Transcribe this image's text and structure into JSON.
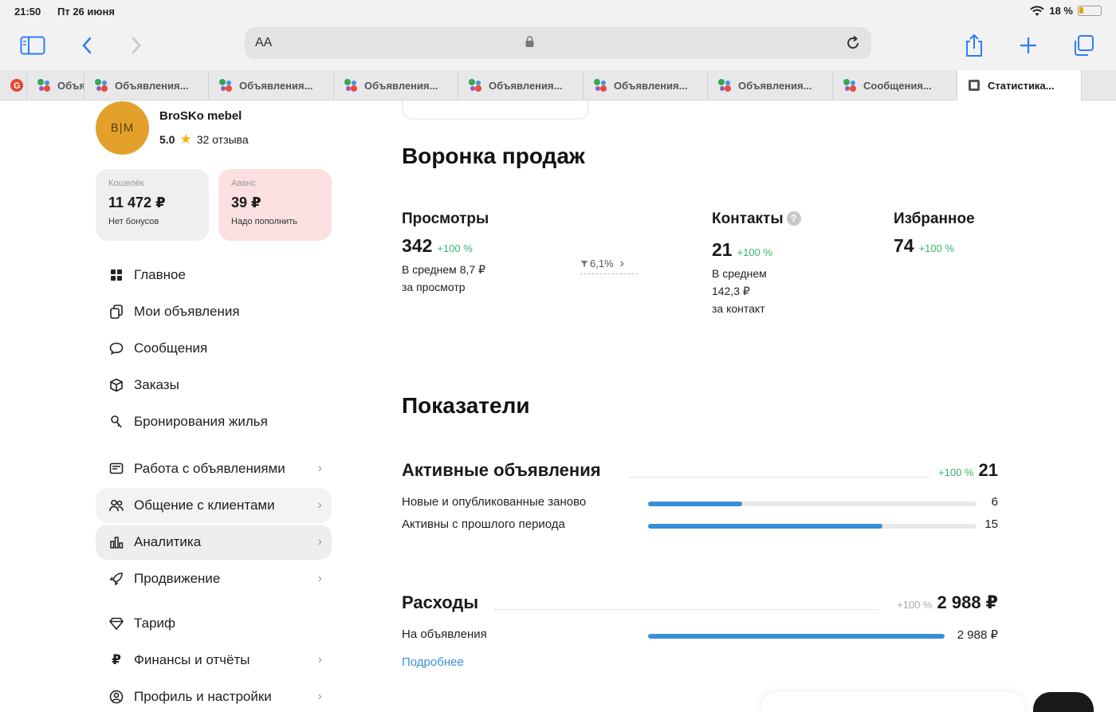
{
  "status": {
    "time": "21:50",
    "date": "Пт 26 июня",
    "battery": "18 %"
  },
  "browser": {
    "url_aa": "AA",
    "tabs": [
      {
        "label": "",
        "fav": "avito",
        "w": 34
      },
      {
        "label": "Объя",
        "fav": "avito",
        "w": 72
      },
      {
        "label": "Объявления...",
        "fav": "avito",
        "w": 156
      },
      {
        "label": "Объявления...",
        "fav": "avito",
        "w": 157
      },
      {
        "label": "Объявления...",
        "fav": "avito",
        "w": 156
      },
      {
        "label": "Объявления...",
        "fav": "avito",
        "w": 157
      },
      {
        "label": "Объявления...",
        "fav": "avito",
        "w": 156
      },
      {
        "label": "Объявления...",
        "fav": "avito",
        "w": 157
      },
      {
        "label": "Сообщения...",
        "fav": "avito",
        "w": 156
      },
      {
        "label": "Статистика...",
        "fav": "stats",
        "w": 156
      }
    ]
  },
  "profile": {
    "initials": "B|M",
    "name": "BroSKo mebel",
    "rating": "5.0",
    "reviews": "32 отзыва"
  },
  "wallet": {
    "label": "Кошелёк",
    "value": "11 472 ₽",
    "sub": "Нет бонусов"
  },
  "advance": {
    "label": "Аванс",
    "value": "39 ₽",
    "sub": "Надо пополнить"
  },
  "nav": {
    "main": "Главное",
    "my_ads": "Мои объявления",
    "messages": "Сообщения",
    "orders": "Заказы",
    "booking": "Бронирования жилья",
    "ads_work": "Работа с объявлениями",
    "clients": "Общение с клиентами",
    "analytics": "Аналитика",
    "promotion": "Продвижение",
    "tariff": "Тариф",
    "finance": "Финансы и отчёты",
    "profile": "Профиль и настройки"
  },
  "funnel": {
    "title": "Воронка продаж",
    "views": {
      "title": "Просмотры",
      "value": "342",
      "growth": "+100 %",
      "sub1": "В среднем 8,7 ₽",
      "sub2": "за просмотр"
    },
    "conversion": "6,1%",
    "contacts": {
      "title": "Контакты",
      "value": "21",
      "growth": "+100 %",
      "sub1": "В среднем",
      "sub2": "142,3 ₽",
      "sub3": "за контакт"
    },
    "favorites": {
      "title": "Избранное",
      "value": "74",
      "growth": "+100 %"
    }
  },
  "indicators": {
    "title": "Показатели",
    "active": {
      "title": "Активные объявления",
      "growth": "+100 %",
      "total": "21",
      "rows": [
        {
          "label": "Новые и опубликованные заново",
          "value": "6",
          "fraction": 0.286
        },
        {
          "label": "Активны с прошлого периода",
          "value": "15",
          "fraction": 0.714
        }
      ]
    },
    "expenses": {
      "title": "Расходы",
      "growth": "+100 %",
      "total": "2 988 ₽",
      "rows": [
        {
          "label": "На объявления",
          "value": "2 988 ₽",
          "fraction": 1.0
        }
      ],
      "more": "Подробнее"
    }
  },
  "colors": {
    "accent": "#3b8fd9",
    "growth": "#35b76a",
    "brand_avatar": "#e3a12c",
    "advance_bg": "#fbe0e2"
  }
}
